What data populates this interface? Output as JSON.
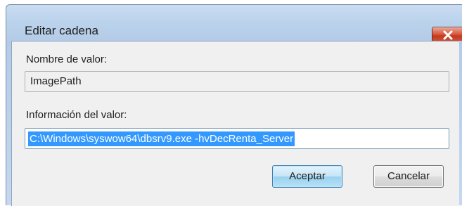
{
  "window": {
    "title": "Editar cadena"
  },
  "value_name": {
    "label": "Nombre de valor:",
    "value": "ImagePath"
  },
  "value_data": {
    "label": "Información del valor:",
    "value": "C:\\Windows\\syswow64\\dbsrv9.exe -hvDecRenta_Server"
  },
  "buttons": {
    "ok_label": "Aceptar",
    "cancel_label": "Cancelar"
  },
  "icons": {
    "close": "close-icon"
  },
  "colors": {
    "selection": "#3399ff",
    "close_button": "#d8553b",
    "titlebar": "#bcd3ec"
  }
}
